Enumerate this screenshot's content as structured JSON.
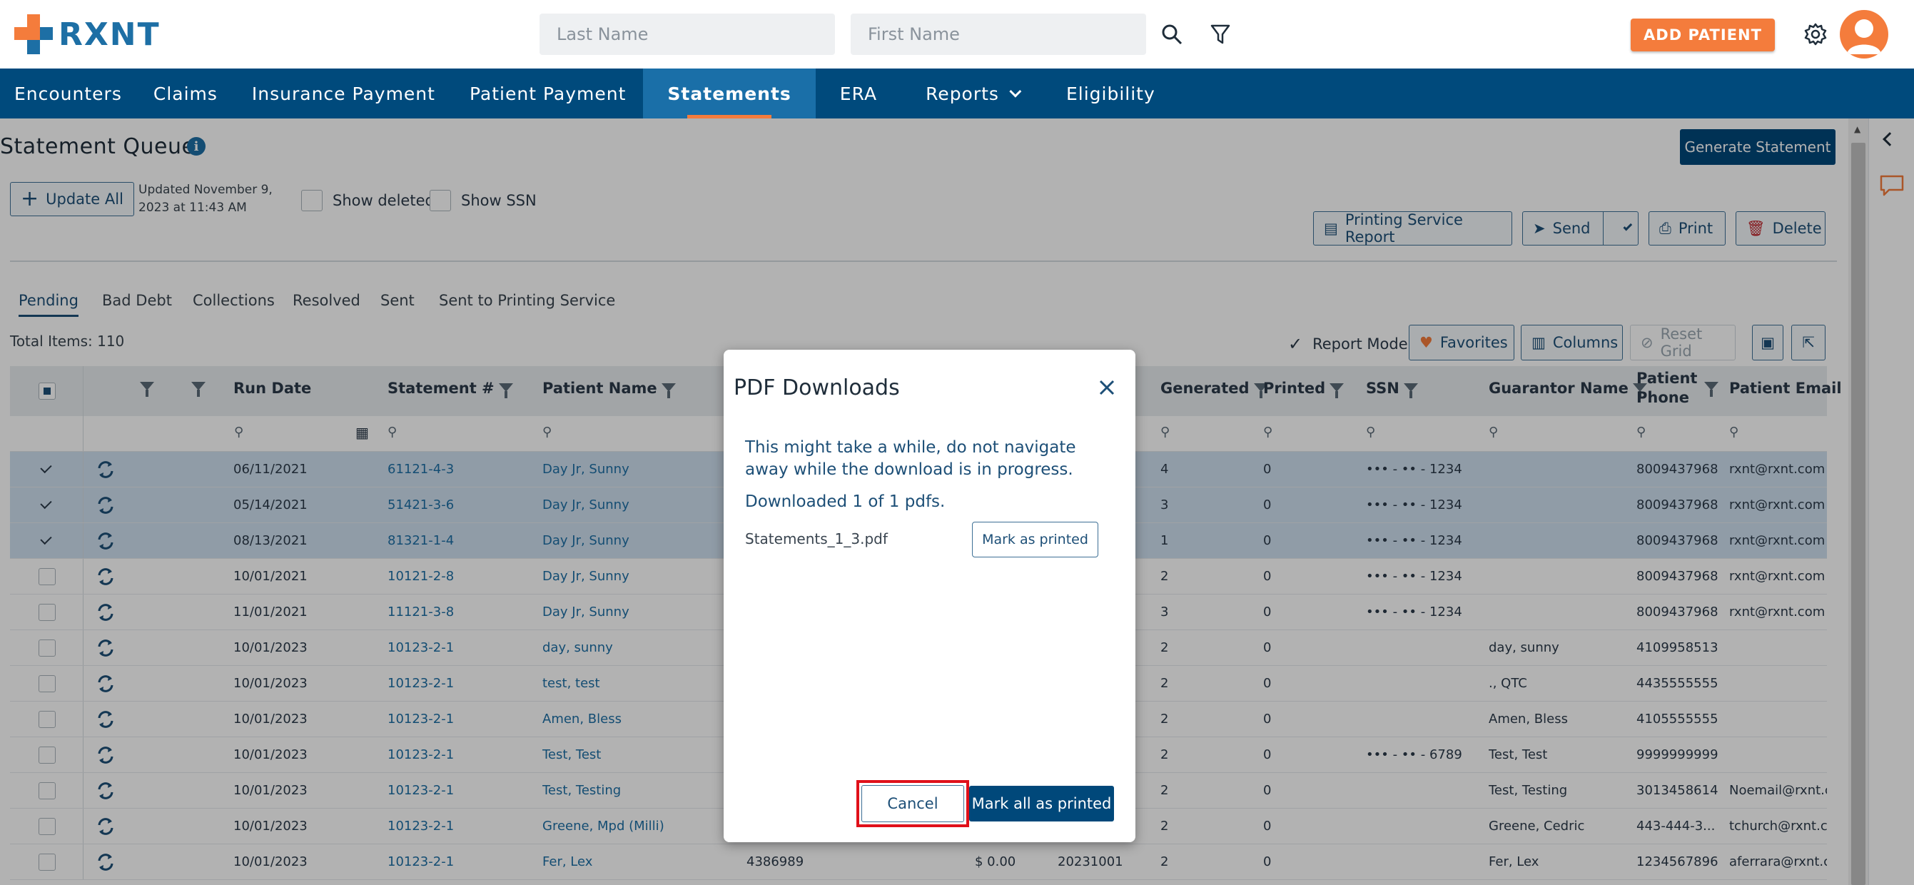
{
  "header": {
    "logo_text": "RXNT",
    "last_name_placeholder": "Last Name",
    "first_name_placeholder": "First Name",
    "add_patient_label": "ADD PATIENT"
  },
  "nav": {
    "items": [
      {
        "label": "Encounters"
      },
      {
        "label": "Claims"
      },
      {
        "label": "Insurance Payment"
      },
      {
        "label": "Patient Payment"
      },
      {
        "label": "Statements"
      },
      {
        "label": "ERA"
      },
      {
        "label": "Reports"
      },
      {
        "label": "Eligibility"
      }
    ],
    "active": "Statements"
  },
  "page": {
    "title": "Statement Queue",
    "generate_label": "Generate Statement",
    "update_all_label": "Update All",
    "updated_line1": "Updated November 9,",
    "updated_line2": "2023 at 11:43 AM",
    "show_deleted_label": "Show deleted",
    "show_ssn_label": "Show SSN",
    "printing_service_label": "Printing Service Report",
    "send_label": "Send",
    "print_label": "Print",
    "delete_label": "Delete",
    "tabs": [
      "Pending",
      "Bad Debt",
      "Collections",
      "Resolved",
      "Sent",
      "Sent to Printing Service"
    ],
    "total_items": "Total Items: 110",
    "report_mode_label": "Report Mode",
    "favorites_label": "Favorites",
    "columns_label": "Columns",
    "reset_grid_label": "Reset Grid"
  },
  "grid": {
    "headers": {
      "run_date": "Run Date",
      "statement": "Statement #",
      "patient_name": "Patient Name",
      "generated": "Generated",
      "printed": "Printed",
      "ssn": "SSN",
      "guarantor": "Guarantor Name",
      "phone_1": "Patient",
      "phone_2": "Phone",
      "email": "Patient Email"
    },
    "rows": [
      {
        "sel": true,
        "run_date": "06/11/2021",
        "statement": "61121-4-3",
        "patient": "Day Jr, Sunny",
        "acct": "",
        "amount": "",
        "date": "",
        "generated": "4",
        "printed": "0",
        "ssn": "••• - •• - 1234",
        "guarantor": "",
        "phone": "8009437968",
        "email": "rxnt@rxnt.com"
      },
      {
        "sel": true,
        "run_date": "05/14/2021",
        "statement": "51421-3-6",
        "patient": "Day Jr, Sunny",
        "acct": "",
        "amount": "",
        "date": "",
        "generated": "3",
        "printed": "0",
        "ssn": "••• - •• - 1234",
        "guarantor": "",
        "phone": "8009437968",
        "email": "rxnt@rxnt.com"
      },
      {
        "sel": true,
        "run_date": "08/13/2021",
        "statement": "81321-1-4",
        "patient": "Day Jr, Sunny",
        "acct": "",
        "amount": "",
        "date": "",
        "generated": "1",
        "printed": "0",
        "ssn": "••• - •• - 1234",
        "guarantor": "",
        "phone": "8009437968",
        "email": "rxnt@rxnt.com"
      },
      {
        "sel": false,
        "run_date": "10/01/2021",
        "statement": "10121-2-8",
        "patient": "Day Jr, Sunny",
        "acct": "",
        "amount": "",
        "date": "",
        "generated": "2",
        "printed": "0",
        "ssn": "••• - •• - 1234",
        "guarantor": "",
        "phone": "8009437968",
        "email": "rxnt@rxnt.com"
      },
      {
        "sel": false,
        "run_date": "11/01/2021",
        "statement": "11121-3-8",
        "patient": "Day Jr, Sunny",
        "acct": "",
        "amount": "",
        "date": "",
        "generated": "3",
        "printed": "0",
        "ssn": "••• - •• - 1234",
        "guarantor": "",
        "phone": "8009437968",
        "email": "rxnt@rxnt.com"
      },
      {
        "sel": false,
        "run_date": "10/01/2023",
        "statement": "10123-2-1",
        "patient": "day, sunny",
        "acct": "",
        "amount": "",
        "date": "",
        "generated": "2",
        "printed": "0",
        "ssn": "",
        "guarantor": "day, sunny",
        "phone": "4109958513",
        "email": ""
      },
      {
        "sel": false,
        "run_date": "10/01/2023",
        "statement": "10123-2-1",
        "patient": "test, test",
        "acct": "",
        "amount": "",
        "date": "",
        "generated": "2",
        "printed": "0",
        "ssn": "",
        "guarantor": "., QTC",
        "phone": "4435555555",
        "email": ""
      },
      {
        "sel": false,
        "run_date": "10/01/2023",
        "statement": "10123-2-1",
        "patient": "Amen, Bless",
        "acct": "",
        "amount": "",
        "date": "",
        "generated": "2",
        "printed": "0",
        "ssn": "",
        "guarantor": "Amen, Bless",
        "phone": "4105555555",
        "email": ""
      },
      {
        "sel": false,
        "run_date": "10/01/2023",
        "statement": "10123-2-1",
        "patient": "Test, Test",
        "acct": "",
        "amount": "",
        "date": "",
        "generated": "2",
        "printed": "0",
        "ssn": "••• - •• - 6789",
        "guarantor": "Test, Test",
        "phone": "9999999999",
        "email": ""
      },
      {
        "sel": false,
        "run_date": "10/01/2023",
        "statement": "10123-2-1",
        "patient": "Test, Testing",
        "acct": "",
        "amount": "",
        "date": "",
        "generated": "2",
        "printed": "0",
        "ssn": "",
        "guarantor": "Test, Testing",
        "phone": "3013458614",
        "email": "Noemail@rxnt.co"
      },
      {
        "sel": false,
        "run_date": "10/01/2023",
        "statement": "10123-2-1",
        "patient": "Greene, Mpd (Milli)",
        "acct": "",
        "amount": "",
        "date": "",
        "generated": "2",
        "printed": "0",
        "ssn": "",
        "guarantor": "Greene, Cedric",
        "phone": "443-444-3...",
        "email": "tchurch@rxnt.co"
      },
      {
        "sel": false,
        "run_date": "10/01/2023",
        "statement": "10123-2-1",
        "patient": "Fer, Lex",
        "acct": "4386989",
        "amount": "$ 0.00",
        "date": "20231001",
        "generated": "2",
        "printed": "0",
        "ssn": "",
        "guarantor": "Fer, Lex",
        "phone": "1234567896",
        "email": "aferrara@rxnt.co"
      }
    ]
  },
  "modal": {
    "title": "PDF Downloads",
    "message": "This might take a while, do not navigate away while the download is in progress.",
    "progress": "Downloaded 1 of 1 pdfs.",
    "file_name": "Statements_1_3.pdf",
    "mark_one_label": "Mark as printed",
    "cancel_label": "Cancel",
    "mark_all_label": "Mark all as printed"
  },
  "colors": {
    "brand_blue": "#004a7c",
    "accent_orange": "#f47c3c",
    "highlight_red": "#e0101a"
  }
}
